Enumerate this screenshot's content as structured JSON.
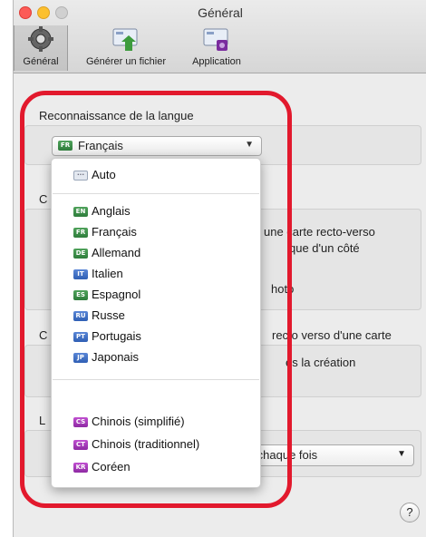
{
  "window": {
    "title": "Général"
  },
  "toolbar": {
    "items": [
      {
        "label": "Général",
        "icon": "gear-icon",
        "selected": true
      },
      {
        "label": "Générer un fichier",
        "icon": "export-card-icon"
      },
      {
        "label": "Application",
        "icon": "app-card-icon"
      }
    ]
  },
  "language_section": {
    "title": "Reconnaissance de la langue",
    "selected": "Français"
  },
  "background": {
    "line1_partial": "C",
    "line2": "une carte recto-verso",
    "line3": "que d'un côté",
    "line4": "hoto",
    "line5": "recto verso d'une carte",
    "line6": "ès la création",
    "line7_partial": "C",
    "line8_partial": "L",
    "combo_value": "ir à chaque fois"
  },
  "dropdown": {
    "groups": [
      [
        {
          "label": "Auto",
          "code": "",
          "color": "auto"
        }
      ],
      [
        {
          "label": "Anglais",
          "code": "EN",
          "color": "g"
        },
        {
          "label": "Français",
          "code": "FR",
          "color": "g"
        },
        {
          "label": "Allemand",
          "code": "DE",
          "color": "g"
        },
        {
          "label": "Italien",
          "code": "IT",
          "color": "b"
        },
        {
          "label": "Espagnol",
          "code": "ES",
          "color": "g"
        },
        {
          "label": "Russe",
          "code": "RU",
          "color": "b"
        },
        {
          "label": "Portugais",
          "code": "PT",
          "color": "b"
        },
        {
          "label": "Japonais",
          "code": "JP",
          "color": "b"
        }
      ],
      [
        {
          "label": "Chinois (simplifié)",
          "code": "CS",
          "color": "p"
        },
        {
          "label": "Chinois (traditionnel)",
          "code": "CT",
          "color": "p"
        },
        {
          "label": "Coréen",
          "code": "KR",
          "color": "p"
        }
      ]
    ]
  },
  "help": {
    "glyph": "?"
  },
  "colors": {
    "highlight": "#e2192d"
  }
}
